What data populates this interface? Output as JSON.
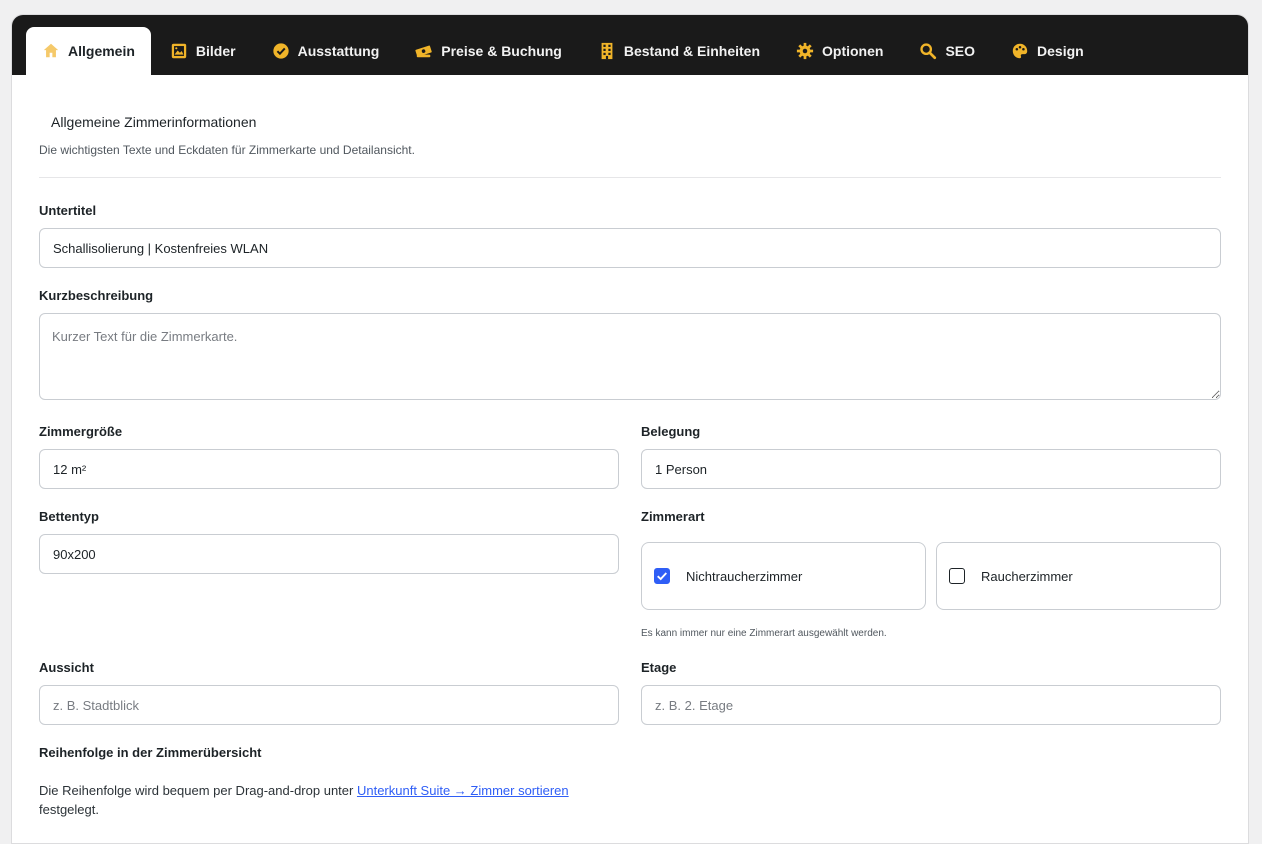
{
  "tabs": [
    {
      "label": "Allgemein",
      "icon": "home-icon",
      "active": true
    },
    {
      "label": "Bilder",
      "icon": "image-icon"
    },
    {
      "label": "Ausstattung",
      "icon": "check-circle-icon"
    },
    {
      "label": "Preise & Buchung",
      "icon": "money-icon"
    },
    {
      "label": "Bestand & Einheiten",
      "icon": "building-icon"
    },
    {
      "label": "Optionen",
      "icon": "gear-icon"
    },
    {
      "label": "SEO",
      "icon": "search-icon"
    },
    {
      "label": "Design",
      "icon": "palette-icon"
    }
  ],
  "section": {
    "title": "Allgemeine Zimmerinformationen",
    "description": "Die wichtigsten Texte und Eckdaten für Zimmerkarte und Detailansicht."
  },
  "fields": {
    "subtitle": {
      "label": "Untertitel",
      "value": "Schallisolierung | Kostenfreies WLAN"
    },
    "short_desc": {
      "label": "Kurzbeschreibung",
      "placeholder": "Kurzer Text für die Zimmerkarte."
    },
    "room_size": {
      "label": "Zimmergröße",
      "value": "12 m²"
    },
    "occupancy": {
      "label": "Belegung",
      "value": "1 Person"
    },
    "bed_type": {
      "label": "Bettentyp",
      "value": "90x200"
    },
    "room_type": {
      "label": "Zimmerart",
      "options": [
        {
          "label": "Nichtraucherzimmer",
          "checked": true
        },
        {
          "label": "Raucherzimmer",
          "checked": false
        }
      ],
      "hint": "Es kann immer nur eine Zimmerart ausgewählt werden."
    },
    "view": {
      "label": "Aussicht",
      "placeholder": "z. B. Stadtblick"
    },
    "floor": {
      "label": "Etage",
      "placeholder": "z. B. 2. Etage"
    },
    "order": {
      "label": "Reihenfolge in der Zimmerübersicht",
      "text_before": "Die Reihenfolge wird bequem per Drag-and-drop unter ",
      "link": "Unterkunft Suite → Zimmer sortieren",
      "text_after": "festgelegt."
    }
  },
  "colors": {
    "tabbar": "#1a1a1a",
    "icon_gold": "#f0b429",
    "accent": "#2f5ef6"
  }
}
